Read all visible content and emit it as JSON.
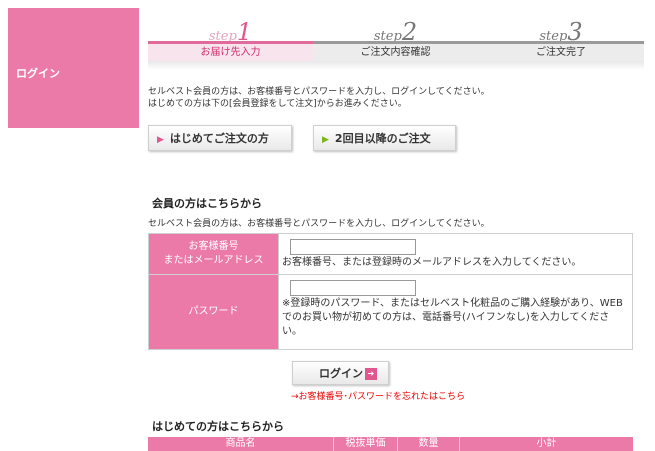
{
  "sidebar": {
    "label": "ログイン"
  },
  "steps": [
    {
      "script": "step",
      "num": "1",
      "label": "お届け先入力",
      "active": true
    },
    {
      "script": "step",
      "num": "2",
      "label": "ご注文内容確認",
      "active": false
    },
    {
      "script": "step",
      "num": "3",
      "label": "ご注文完了",
      "active": false
    }
  ],
  "intro": {
    "line1": "セルベスト会員の方は、お客様番号とパスワードを入力し、ログインしてください。",
    "line2": "はじめての方は下の[会員登録をして注文]からお進みください。"
  },
  "buttons": {
    "new_order": "はじめてご注文の方",
    "repeat_order": "2回目以降のご注文"
  },
  "member": {
    "heading": "会員の方はこちらから",
    "note": "セルベスト会員の方は、お客様番号とパスワードを入力し、ログインしてください。",
    "customer_label_1": "お客様番号",
    "customer_label_2": "またはメールアドレス",
    "customer_value": "",
    "customer_help": "お客様番号、または登録時のメールアドレスを入力してください。",
    "password_label": "パスワード",
    "password_value": "",
    "password_help": "※登録時のパスワード、またはセルベスト化粧品のご購入経験があり、WEBでのお買い物が初めての方は、電話番号(ハイフンなし)を入力してください。",
    "login_button": "ログイン",
    "forgot_link": "→お客様番号･パスワードを忘れたはこちら"
  },
  "new_customer": {
    "heading": "はじめての方はこちらから",
    "columns": [
      "商品名",
      "税抜単価",
      "数量",
      "小計"
    ]
  },
  "colors": {
    "pink": "#ec7aa9",
    "accent": "#e0568f",
    "green": "#7bb31a",
    "link_red": "#ee0000"
  }
}
